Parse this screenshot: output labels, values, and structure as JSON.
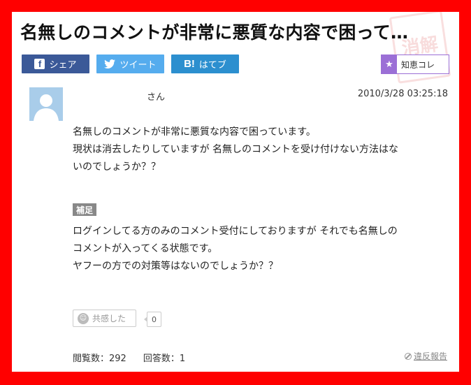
{
  "question": {
    "title": "名無しのコメントが非常に悪質な内容で困って…",
    "username": "さん",
    "timestamp": "2010/3/28  03:25:18",
    "body_lines": [
      "名無しのコメントが非常に悪質な内容で困っています。",
      "現状は消去したりしていますが 名無しのコメントを受け付けない方法はな",
      "いのでしょうか？？"
    ],
    "supplement_label": "補足",
    "supplement_lines": [
      "ログインしてる方のみのコメント受付にしておりますが それでも名無しの",
      "コメントが入ってくる状態です。",
      "ヤフーの方での対策等はないのでしょうか？？"
    ]
  },
  "share": {
    "facebook_label": "シェア",
    "twitter_label": "ツイート",
    "hatena_label": "はてブ",
    "hatena_icon_text": "B!",
    "chiekore_label": "知恵コレ"
  },
  "stamp_text": "消解",
  "empathy": {
    "label": "共感した",
    "count": "0"
  },
  "stats": {
    "views": "閲覧数：292",
    "answers": "回答数：1"
  },
  "report_label": "違反報告",
  "colors": {
    "frame": "#ff0000",
    "facebook": "#3b5998",
    "twitter": "#55acee",
    "hatena": "#2c8fcf",
    "chiekore": "#9b6fd6"
  }
}
